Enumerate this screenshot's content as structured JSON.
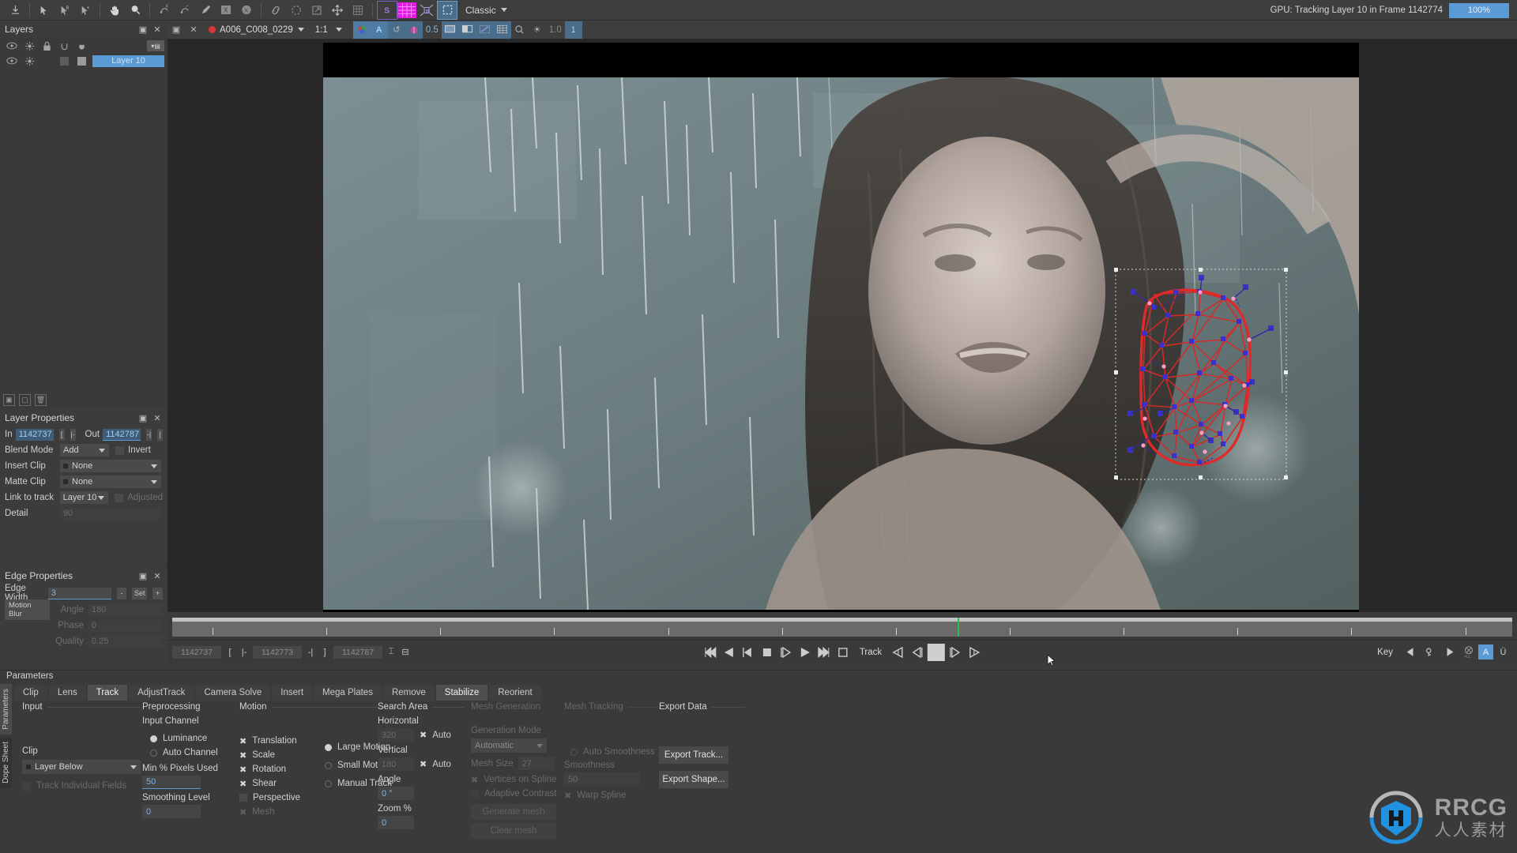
{
  "app": {
    "preset": "Classic",
    "status_text": "GPU: Tracking Layer 10 in Frame 1142774",
    "status_percent": "100%"
  },
  "toolbar": {
    "icons": [
      {
        "name": "import-icon",
        "glyph": "⤓"
      },
      {
        "name": "select-tool-icon",
        "glyph": "➤"
      },
      {
        "name": "select-b-tool-icon",
        "glyph": "➤"
      },
      {
        "name": "select-add-tool-icon",
        "glyph": "➤"
      },
      {
        "name": "pan-hand-icon",
        "glyph": "✋"
      },
      {
        "name": "zoom-magnifier-icon",
        "glyph": "🔍"
      },
      {
        "name": "xspline-tool-icon",
        "glyph": "X"
      },
      {
        "name": "bezier-tool-icon",
        "glyph": "B"
      },
      {
        "name": "brush-tool-icon",
        "glyph": "✏"
      },
      {
        "name": "xspline-layer-icon",
        "glyph": "X"
      },
      {
        "name": "ellipse-layer-icon",
        "glyph": "X"
      },
      {
        "name": "link-icon",
        "glyph": "🔗"
      },
      {
        "name": "lasso-icon",
        "glyph": "◌"
      },
      {
        "name": "transform-icon",
        "glyph": "⬈"
      },
      {
        "name": "move-icon",
        "glyph": "✛"
      },
      {
        "name": "grid-icon",
        "glyph": "▦"
      },
      {
        "name": "surface-s-icon",
        "glyph": "S"
      },
      {
        "name": "magenta-grid-icon",
        "glyph": "▦"
      },
      {
        "name": "planar-corner-icon",
        "glyph": "⤧"
      },
      {
        "name": "selection-marquee-icon",
        "glyph": "⬚"
      }
    ]
  },
  "clipbar": {
    "clip_name": "A006_C008_0229",
    "ratio": "1:1",
    "value_05": "0.5",
    "value_10": "1.0",
    "buttons": [
      {
        "name": "channel-rgb-icon",
        "glyph": "◉"
      },
      {
        "name": "alpha-channel-icon",
        "glyph": "A"
      },
      {
        "name": "refresh-icon",
        "glyph": "↺"
      },
      {
        "name": "matte-overlay-icon",
        "glyph": "◍"
      }
    ],
    "view_buttons": [
      {
        "name": "monitor-view-icon",
        "glyph": "▭"
      },
      {
        "name": "dual-view-icon",
        "glyph": "◨"
      },
      {
        "name": "spline-view-icon",
        "glyph": "╱"
      },
      {
        "name": "grid-view-icon",
        "glyph": "▦"
      },
      {
        "name": "magnify-view-icon",
        "glyph": "◉"
      },
      {
        "name": "light-view-icon",
        "glyph": "☀"
      },
      {
        "name": "number-view-icon",
        "glyph": "1"
      }
    ]
  },
  "layers": {
    "title": "Layers",
    "header_icons": [
      {
        "name": "eye-visibility-icon",
        "glyph": "◉"
      },
      {
        "name": "light-icon",
        "glyph": "✳"
      },
      {
        "name": "lock-icon",
        "glyph": "🔒"
      },
      {
        "name": "matte-u-icon",
        "glyph": "∪"
      },
      {
        "name": "matte-filled-icon",
        "glyph": "◡"
      }
    ],
    "rows": [
      {
        "name": "Layer 10",
        "selected": true
      }
    ]
  },
  "layer_properties": {
    "title": "Layer Properties",
    "in_label": "In",
    "in_value": "1142737",
    "out_label": "Out",
    "out_value": "1142787",
    "blend_mode_label": "Blend Mode",
    "blend_mode_value": "Add",
    "invert_label": "Invert",
    "insert_clip_label": "Insert Clip",
    "insert_clip_value": "None",
    "matte_clip_label": "Matte Clip",
    "matte_clip_value": "None",
    "link_to_track_label": "Link to track",
    "link_to_track_value": "Layer 10",
    "adjusted_label": "Adjusted",
    "detail_label": "Detail",
    "detail_value": "90"
  },
  "edge_properties": {
    "title": "Edge Properties",
    "edge_width_label": "Edge Width",
    "edge_width_value": "3",
    "minus": "-",
    "set": "Set",
    "plus": "+",
    "motion_blur_label": "Motion Blur",
    "angle_label": "Angle",
    "angle_value": "180",
    "phase_label": "Phase",
    "phase_value": "0",
    "quality_label": "Quality",
    "quality_value": "0.25"
  },
  "timeline": {
    "in_frame": "1142737",
    "current_frame": "1142773",
    "out_frame": "1142787",
    "track_label": "Track",
    "key_label": "Key",
    "key_a": "A",
    "key_u": "Ü",
    "all_label": "ALL"
  },
  "parameters": {
    "title": "Parameters",
    "vtabs": [
      "Parameters",
      "Dope Sheet"
    ],
    "tabs": [
      {
        "label": "Clip",
        "active": false
      },
      {
        "label": "Lens",
        "active": false
      },
      {
        "label": "Track",
        "active": true
      },
      {
        "label": "AdjustTrack",
        "active": false
      },
      {
        "label": "Camera Solve",
        "active": false
      },
      {
        "label": "Insert",
        "active": false
      },
      {
        "label": "Mega Plates",
        "active": false
      },
      {
        "label": "Remove",
        "active": false
      },
      {
        "label": "Stabilize",
        "active": false
      },
      {
        "label": "Reorient",
        "active": false
      }
    ],
    "input": {
      "group": "Input",
      "clip_label": "Clip",
      "clip_value": "Layer Below",
      "track_individual_fields": "Track Individual Fields"
    },
    "preprocessing": {
      "group": "Preprocessing",
      "input_channel_label": "Input Channel",
      "luminance": "Luminance",
      "auto_channel": "Auto Channel",
      "min_pixels_label": "Min % Pixels Used",
      "min_pixels_value": "50",
      "smoothing_label": "Smoothing Level",
      "smoothing_value": "0"
    },
    "motion": {
      "group": "Motion",
      "checks": [
        {
          "label": "Translation",
          "on": true,
          "dim": false
        },
        {
          "label": "Scale",
          "on": true,
          "dim": false
        },
        {
          "label": "Rotation",
          "on": true,
          "dim": false
        },
        {
          "label": "Shear",
          "on": true,
          "dim": false
        },
        {
          "label": "Perspective",
          "on": false,
          "dim": false
        },
        {
          "label": "Mesh",
          "on": true,
          "dim": true
        }
      ],
      "radios": [
        {
          "label": "Large Motion",
          "on": true
        },
        {
          "label": "Small Motion",
          "on": false
        },
        {
          "label": "Manual Track",
          "on": false
        }
      ]
    },
    "search_area": {
      "group": "Search Area",
      "horizontal_label": "Horizontal",
      "horizontal_value": "320",
      "horizontal_auto": "Auto",
      "vertical_label": "Vertical",
      "vertical_value": "180",
      "vertical_auto": "Auto",
      "angle_label": "Angle",
      "angle_value": "0 °",
      "zoom_label": "Zoom %",
      "zoom_value": "0"
    },
    "mesh_generation": {
      "group": "Mesh Generation",
      "generation_mode_label": "Generation Mode",
      "generation_mode_value": "Automatic",
      "mesh_size_label": "Mesh Size",
      "mesh_size_value": "27",
      "vertices_on_spline": "Vertices on Spline",
      "adaptive_contrast": "Adaptive Contrast",
      "generate_mesh": "Generate mesh",
      "clear_mesh": "Clear mesh"
    },
    "mesh_tracking": {
      "group": "Mesh Tracking",
      "auto_smoothness": "Auto Smoothness",
      "smoothness_label": "Smoothness",
      "smoothness_value": "50",
      "warp_spline": "Warp Spline"
    },
    "export_data": {
      "group": "Export Data",
      "export_track": "Export Track...",
      "export_shape": "Export Shape..."
    }
  },
  "watermark": {
    "brand": "RRCG",
    "sub": "人人素材"
  },
  "colors": {
    "accent_blue": "#5b9bd5",
    "mesh_red": "#e03030",
    "mesh_node_blue": "#3a2fd0",
    "playhead_green": "#2fbf4f",
    "panel_bg": "#3a3a3a"
  }
}
